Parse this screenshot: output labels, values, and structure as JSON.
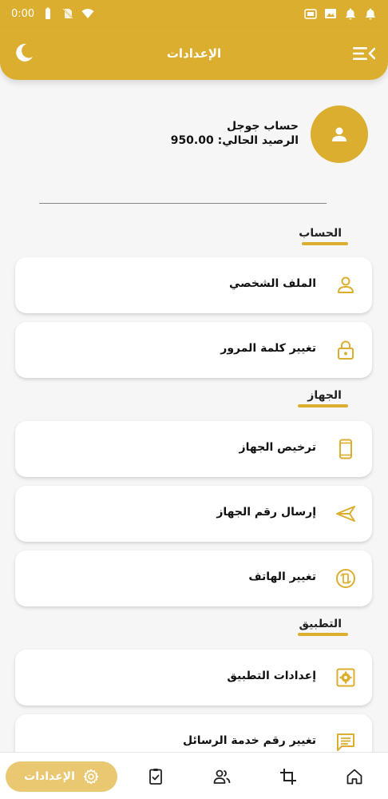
{
  "status_bar": {
    "time": "0:00"
  },
  "app_bar": {
    "title": "الإعدادات"
  },
  "profile": {
    "name": "حساب جوجل",
    "balance": "الرصيد الحالي: 950.00"
  },
  "sections": {
    "account": "الحساب",
    "device": "الجهاز",
    "application": "التطبيق"
  },
  "items": {
    "profile": "الملف الشخصي",
    "change_password": "تغيير كلمة المرور",
    "device_license": "ترخيص الجهاز",
    "send_device_number": "إرسال رقم الجهاز",
    "change_phone": "تغيير الهاتف",
    "app_settings": "إعدادات التطبيق",
    "change_sms_number": "تغيير رقم خدمة الرسائل"
  },
  "bottom_nav": {
    "active_label": "الإعدادات"
  },
  "colors": {
    "accent": "#dcae30",
    "accent_light": "#e9c871",
    "background": "#f6f6f6"
  }
}
